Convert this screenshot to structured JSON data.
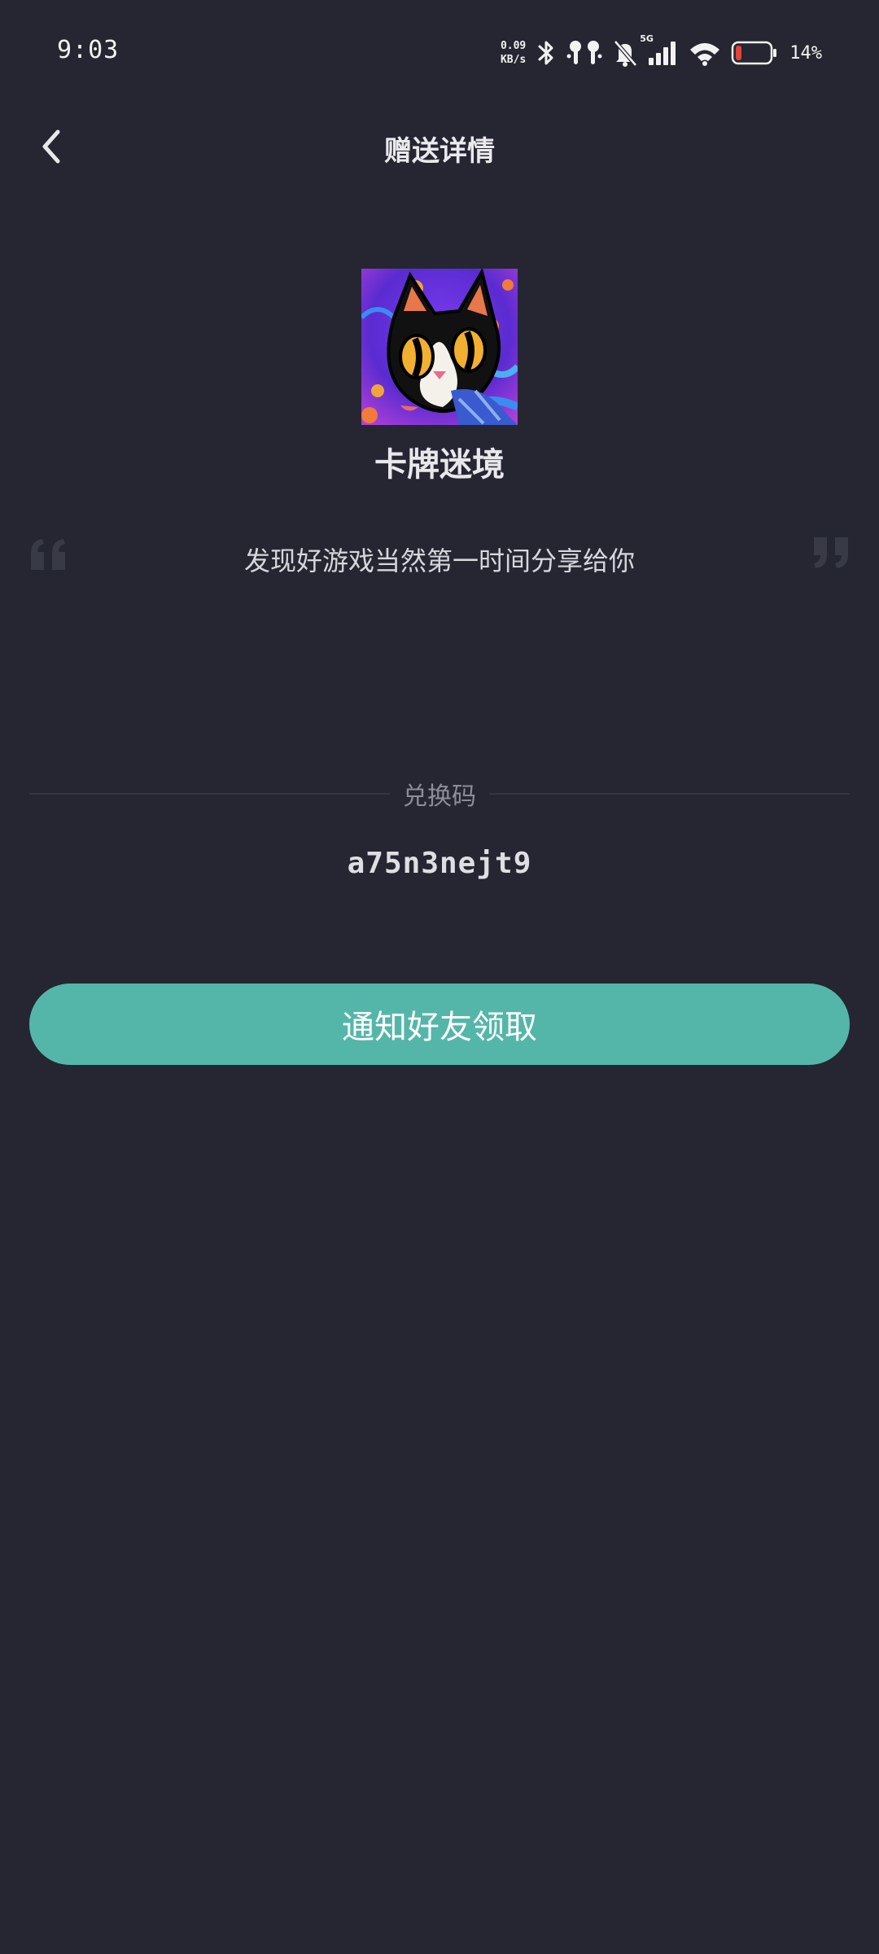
{
  "status_bar": {
    "time": "9:03",
    "net_speed_value": "0.09",
    "net_speed_unit": "KB/s",
    "signal_type": "5G",
    "battery_percent": "14%",
    "icons": [
      "bluetooth-icon",
      "earbuds-icon",
      "mute-bell-icon",
      "cellular-signal-icon",
      "wifi-icon",
      "battery-icon"
    ]
  },
  "header": {
    "title": "赠送详情",
    "back_icon": "chevron-left-icon"
  },
  "game": {
    "name": "卡牌迷境"
  },
  "message": {
    "text": "发现好游戏当然第一时间分享给你"
  },
  "redeem": {
    "label": "兑换码",
    "code": "a75n3nejt9"
  },
  "actions": {
    "notify_label": "通知好友领取"
  },
  "colors": {
    "background": "#252632",
    "accent": "#54b6a9",
    "battery_low": "#e0443c"
  }
}
